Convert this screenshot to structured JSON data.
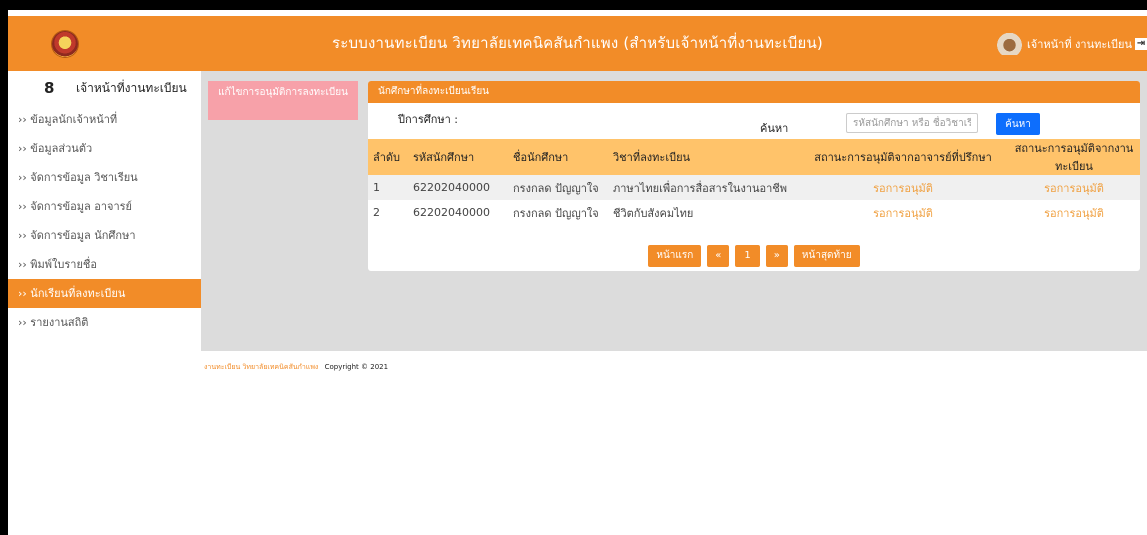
{
  "header": {
    "title": "ระบบงานทะเบียน วิทยาลัยเทคนิคสันกำแพง (สำหรับเจ้าหน้าที่งานทะเบียน)",
    "user_name": "เจ้าหน้าที่ งานทะเบียน",
    "accent": "#f28c28"
  },
  "sidebar": {
    "user_label": "เจ้าหน้าที่งานทะเบียน",
    "items": [
      {
        "label": "›› ข้อมูลนักเจ้าหน้าที่"
      },
      {
        "label": "›› ข้อมูลส่วนตัว"
      },
      {
        "label": "›› จัดการข้อมูล วิชาเรียน"
      },
      {
        "label": "›› จัดการข้อมูล อาจารย์"
      },
      {
        "label": "›› จัดการข้อมูล นักศึกษา"
      },
      {
        "label": "›› พิมพ์ใบรายชื่อ"
      },
      {
        "label": "›› นักเรียนที่ลงทะเบียน"
      },
      {
        "label": "›› รายงานสถิติ"
      }
    ]
  },
  "approve_button": "แก้ไขการอนุมัติการลงทะเบียน",
  "panel": {
    "title": "นักศึกษาที่ลงทะเบียนเรียน",
    "year_label": "ปีการศึกษา :",
    "search_label": "ค้นหา",
    "search_placeholder": "รหัสนักศึกษา หรือ ชื่อวิชาเรียน",
    "search_button": "ค้นหา",
    "columns": [
      "ลำดับ",
      "รหัสนักศึกษา",
      "ชื่อนักศึกษา",
      "วิชาที่ลงทะเบียน",
      "สถานะการอนุมัติจากอาจารย์ที่ปรึกษา",
      "สถานะการอนุมัติจากงานทะเบียน"
    ],
    "rows": [
      {
        "no": "1",
        "student_id": "62202040000",
        "name": "กรงกลด ปัญญาใจ",
        "subject": "ภาษาไทยเพื่อการสื่อสารในงานอาชีพ",
        "advisor_status": "รอการอนุมัติ",
        "registrar_status": "รอการอนุมัติ"
      },
      {
        "no": "2",
        "student_id": "62202040000",
        "name": "กรงกลด ปัญญาใจ",
        "subject": "ชีวิตกับสังคมไทย",
        "advisor_status": "รอการอนุมัติ",
        "registrar_status": "รอการอนุมัติ"
      }
    ],
    "pagination": {
      "first": "หน้าแรก",
      "prev": "«",
      "page": "1",
      "next": "»",
      "last": "หน้าสุดท้าย"
    }
  },
  "footer": {
    "org": "งานทะเบียน วิทยาลัยเทคนิคสันกำแพง",
    "copyright": "Copyright © 2021"
  }
}
